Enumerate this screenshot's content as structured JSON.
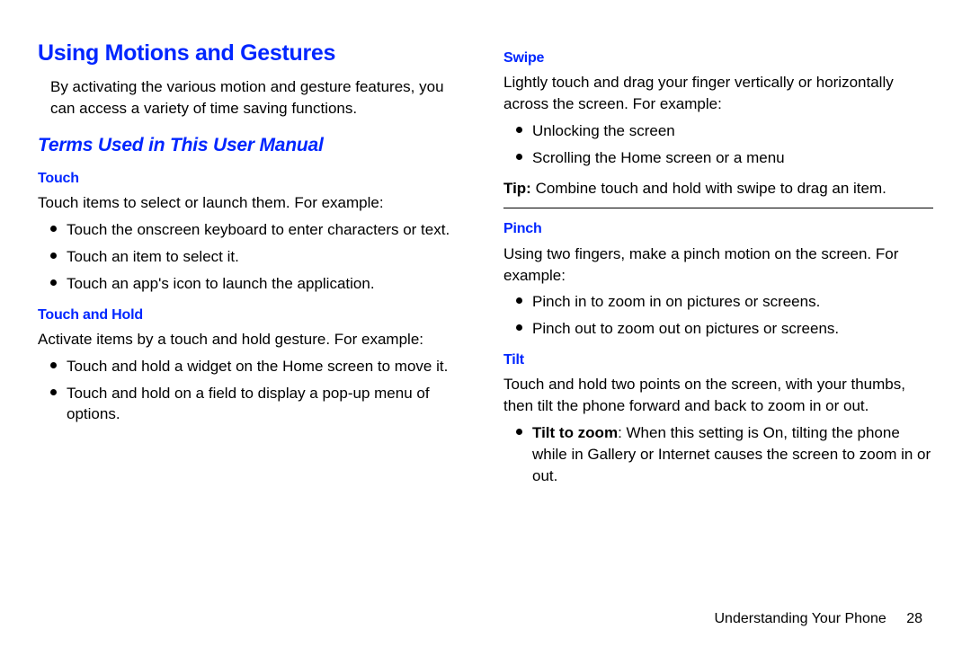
{
  "colors": {
    "accent": "#0026ff",
    "text": "#000000",
    "bg": "#ffffff"
  },
  "left": {
    "h1": "Using Motions and Gestures",
    "intro": "By activating the various motion and gesture features, you can access a variety of time saving functions.",
    "h2": "Terms Used in This User Manual",
    "touch": {
      "h3": "Touch",
      "lead": "Touch items to select or launch them. For example:",
      "items": [
        "Touch the onscreen keyboard to enter characters or text.",
        "Touch an item to select it.",
        "Touch an app's icon to launch the application."
      ]
    },
    "touchHold": {
      "h3": "Touch and Hold",
      "lead": "Activate items by a touch and hold gesture. For example:",
      "items": [
        "Touch and hold a widget on the Home screen to move it.",
        "Touch and hold on a field to display a pop-up menu of options."
      ]
    }
  },
  "right": {
    "swipe": {
      "h3": "Swipe",
      "lead": "Lightly touch and drag your finger vertically or horizontally across the screen. For example:",
      "items": [
        "Unlocking the screen",
        "Scrolling the Home screen or a menu"
      ],
      "tipLabel": "Tip:",
      "tipText": " Combine touch and hold with swipe to drag an item."
    },
    "pinch": {
      "h3": "Pinch",
      "lead": "Using two fingers, make a pinch motion on the screen. For example:",
      "items": [
        "Pinch in to zoom in on pictures or screens.",
        "Pinch out to zoom out on pictures or screens."
      ]
    },
    "tilt": {
      "h3": "Tilt",
      "lead": "Touch and hold two points on the screen, with your thumbs, then tilt the phone forward and back to zoom in or out.",
      "bullet1Label": "Tilt to zoom",
      "bullet1Text": ": When this setting is On, tilting the phone while in Gallery or Internet causes the screen to zoom in or out."
    }
  },
  "footer": {
    "section": "Understanding Your Phone",
    "page": "28"
  }
}
